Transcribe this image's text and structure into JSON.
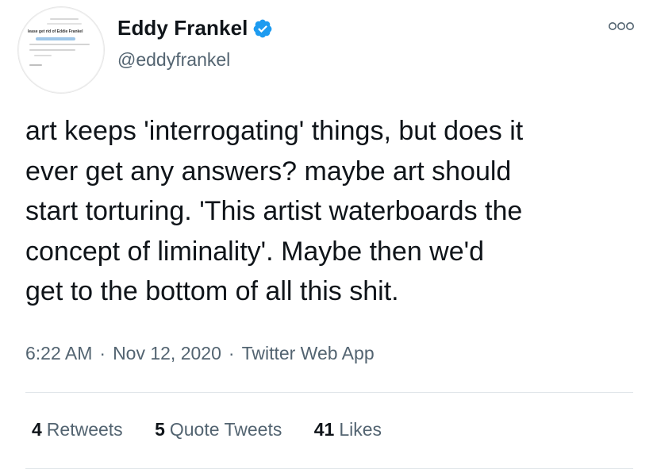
{
  "author": {
    "name": "Eddy Frankel",
    "handle": "@eddyfrankel",
    "verified_color": "#1d9bf0",
    "avatar_text": {
      "heading": "lease get rid of Eddie Frankel"
    }
  },
  "tweet": {
    "text": "art keeps 'interrogating' things, but does it\never get any answers? maybe art should\nstart torturing. 'This artist waterboards the\nconcept of liminality'. Maybe then we'd\nget to the bottom of all this shit.",
    "time": "6:22 AM",
    "date": "Nov 12, 2020",
    "source": "Twitter Web App",
    "separator": "·"
  },
  "stats": {
    "retweets_count": "4",
    "retweets_label": "Retweets",
    "quotes_count": "5",
    "quotes_label": "Quote Tweets",
    "likes_count": "41",
    "likes_label": "Likes"
  },
  "icons": {
    "more": "more-options-icon",
    "verified": "verified-badge-icon"
  }
}
